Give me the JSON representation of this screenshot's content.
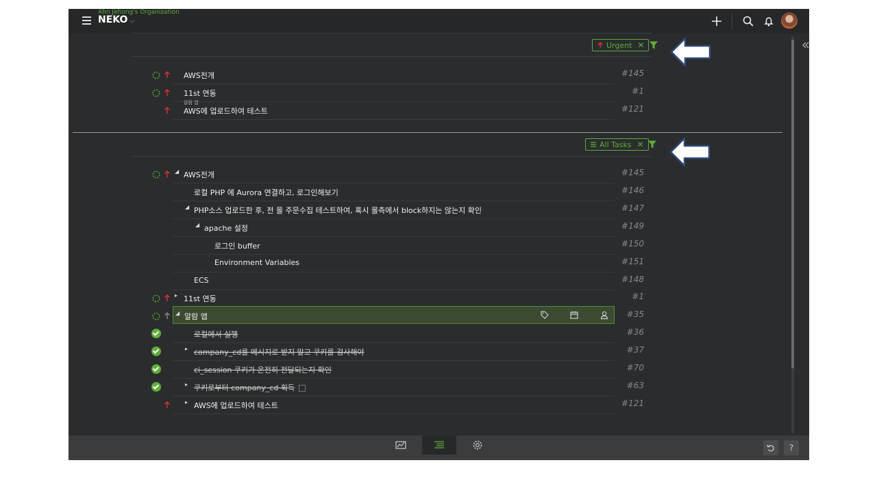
{
  "header": {
    "organization": "Ahn Jehong's Organization",
    "project": "NEKO",
    "project_chevron": "⌵"
  },
  "urgent_panel": {
    "filter_label": "Urgent",
    "tasks": [
      {
        "title": "AWS전개",
        "number": "#145"
      },
      {
        "title": "11st 연동",
        "number": "#1"
      },
      {
        "title": "AWS에 업로드하여 테스트",
        "number": "#121",
        "parent": "알람 앱"
      }
    ]
  },
  "all_panel": {
    "filter_label": "All Tasks",
    "tasks": [
      {
        "title": "AWS전개",
        "number": "#145",
        "toggle": "◢",
        "done": false
      },
      {
        "title": "로컬 PHP 에 Aurora 연결하고, 로그인해보기",
        "number": "#146",
        "done": false
      },
      {
        "title": "PHP소스 업로드한 후, 전 몰 주문수집 테스트하여, 혹시 몰측에서 block하지는 않는지 확인",
        "number": "#147",
        "toggle": "◢",
        "done": false
      },
      {
        "title": "apache 설정",
        "number": "#149",
        "toggle": "◢",
        "done": false
      },
      {
        "title": "로그인 buffer",
        "number": "#150",
        "done": false
      },
      {
        "title": "Environment Variables",
        "number": "#151",
        "done": false
      },
      {
        "title": "ECS",
        "number": "#148",
        "done": false
      },
      {
        "title": "11st 연동",
        "number": "#1",
        "toggle": "▸",
        "done": false
      },
      {
        "title": "알람 앱",
        "number": "#35",
        "toggle": "◢",
        "done": false
      },
      {
        "title": "로컬에서 실행",
        "number": "#36",
        "done": true
      },
      {
        "title": "company_cd를 메시지로 받지 말고 쿠키를 검사해야",
        "number": "#37",
        "toggle": "▸",
        "done": true
      },
      {
        "title": "ci_session 쿠키가 온전히 전달되는지 확인",
        "number": "#70",
        "done": true
      },
      {
        "title": "쿠키로부터 company_cd 획득",
        "number": "#63",
        "toggle": "▸",
        "done": true
      },
      {
        "title": "AWS에 업로드하여 테스트",
        "number": "#121",
        "toggle": "▸",
        "done": false
      }
    ]
  },
  "footer": {
    "help_label": "?"
  },
  "colors": {
    "accent": "#5fae3c",
    "urgent": "#e0332b",
    "background": "#2a2c2d"
  }
}
